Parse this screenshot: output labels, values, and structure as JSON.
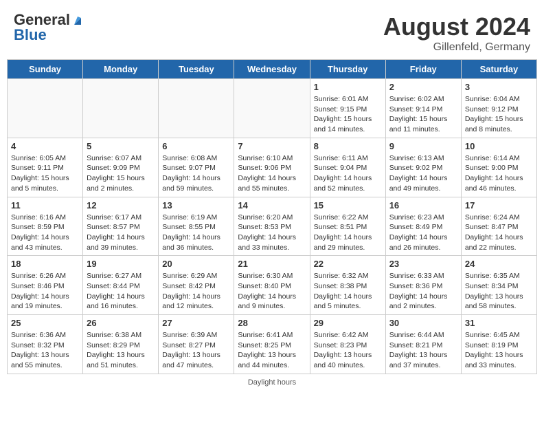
{
  "header": {
    "logo_general": "General",
    "logo_blue": "Blue",
    "title": "August 2024",
    "location": "Gillenfeld, Germany"
  },
  "days_of_week": [
    "Sunday",
    "Monday",
    "Tuesday",
    "Wednesday",
    "Thursday",
    "Friday",
    "Saturday"
  ],
  "weeks": [
    [
      {
        "day": "",
        "info": ""
      },
      {
        "day": "",
        "info": ""
      },
      {
        "day": "",
        "info": ""
      },
      {
        "day": "",
        "info": ""
      },
      {
        "day": "1",
        "info": "Sunrise: 6:01 AM\nSunset: 9:15 PM\nDaylight: 15 hours\nand 14 minutes."
      },
      {
        "day": "2",
        "info": "Sunrise: 6:02 AM\nSunset: 9:14 PM\nDaylight: 15 hours\nand 11 minutes."
      },
      {
        "day": "3",
        "info": "Sunrise: 6:04 AM\nSunset: 9:12 PM\nDaylight: 15 hours\nand 8 minutes."
      }
    ],
    [
      {
        "day": "4",
        "info": "Sunrise: 6:05 AM\nSunset: 9:11 PM\nDaylight: 15 hours\nand 5 minutes."
      },
      {
        "day": "5",
        "info": "Sunrise: 6:07 AM\nSunset: 9:09 PM\nDaylight: 15 hours\nand 2 minutes."
      },
      {
        "day": "6",
        "info": "Sunrise: 6:08 AM\nSunset: 9:07 PM\nDaylight: 14 hours\nand 59 minutes."
      },
      {
        "day": "7",
        "info": "Sunrise: 6:10 AM\nSunset: 9:06 PM\nDaylight: 14 hours\nand 55 minutes."
      },
      {
        "day": "8",
        "info": "Sunrise: 6:11 AM\nSunset: 9:04 PM\nDaylight: 14 hours\nand 52 minutes."
      },
      {
        "day": "9",
        "info": "Sunrise: 6:13 AM\nSunset: 9:02 PM\nDaylight: 14 hours\nand 49 minutes."
      },
      {
        "day": "10",
        "info": "Sunrise: 6:14 AM\nSunset: 9:00 PM\nDaylight: 14 hours\nand 46 minutes."
      }
    ],
    [
      {
        "day": "11",
        "info": "Sunrise: 6:16 AM\nSunset: 8:59 PM\nDaylight: 14 hours\nand 43 minutes."
      },
      {
        "day": "12",
        "info": "Sunrise: 6:17 AM\nSunset: 8:57 PM\nDaylight: 14 hours\nand 39 minutes."
      },
      {
        "day": "13",
        "info": "Sunrise: 6:19 AM\nSunset: 8:55 PM\nDaylight: 14 hours\nand 36 minutes."
      },
      {
        "day": "14",
        "info": "Sunrise: 6:20 AM\nSunset: 8:53 PM\nDaylight: 14 hours\nand 33 minutes."
      },
      {
        "day": "15",
        "info": "Sunrise: 6:22 AM\nSunset: 8:51 PM\nDaylight: 14 hours\nand 29 minutes."
      },
      {
        "day": "16",
        "info": "Sunrise: 6:23 AM\nSunset: 8:49 PM\nDaylight: 14 hours\nand 26 minutes."
      },
      {
        "day": "17",
        "info": "Sunrise: 6:24 AM\nSunset: 8:47 PM\nDaylight: 14 hours\nand 22 minutes."
      }
    ],
    [
      {
        "day": "18",
        "info": "Sunrise: 6:26 AM\nSunset: 8:46 PM\nDaylight: 14 hours\nand 19 minutes."
      },
      {
        "day": "19",
        "info": "Sunrise: 6:27 AM\nSunset: 8:44 PM\nDaylight: 14 hours\nand 16 minutes."
      },
      {
        "day": "20",
        "info": "Sunrise: 6:29 AM\nSunset: 8:42 PM\nDaylight: 14 hours\nand 12 minutes."
      },
      {
        "day": "21",
        "info": "Sunrise: 6:30 AM\nSunset: 8:40 PM\nDaylight: 14 hours\nand 9 minutes."
      },
      {
        "day": "22",
        "info": "Sunrise: 6:32 AM\nSunset: 8:38 PM\nDaylight: 14 hours\nand 5 minutes."
      },
      {
        "day": "23",
        "info": "Sunrise: 6:33 AM\nSunset: 8:36 PM\nDaylight: 14 hours\nand 2 minutes."
      },
      {
        "day": "24",
        "info": "Sunrise: 6:35 AM\nSunset: 8:34 PM\nDaylight: 13 hours\nand 58 minutes."
      }
    ],
    [
      {
        "day": "25",
        "info": "Sunrise: 6:36 AM\nSunset: 8:32 PM\nDaylight: 13 hours\nand 55 minutes."
      },
      {
        "day": "26",
        "info": "Sunrise: 6:38 AM\nSunset: 8:29 PM\nDaylight: 13 hours\nand 51 minutes."
      },
      {
        "day": "27",
        "info": "Sunrise: 6:39 AM\nSunset: 8:27 PM\nDaylight: 13 hours\nand 47 minutes."
      },
      {
        "day": "28",
        "info": "Sunrise: 6:41 AM\nSunset: 8:25 PM\nDaylight: 13 hours\nand 44 minutes."
      },
      {
        "day": "29",
        "info": "Sunrise: 6:42 AM\nSunset: 8:23 PM\nDaylight: 13 hours\nand 40 minutes."
      },
      {
        "day": "30",
        "info": "Sunrise: 6:44 AM\nSunset: 8:21 PM\nDaylight: 13 hours\nand 37 minutes."
      },
      {
        "day": "31",
        "info": "Sunrise: 6:45 AM\nSunset: 8:19 PM\nDaylight: 13 hours\nand 33 minutes."
      }
    ]
  ],
  "footer": "Daylight hours"
}
